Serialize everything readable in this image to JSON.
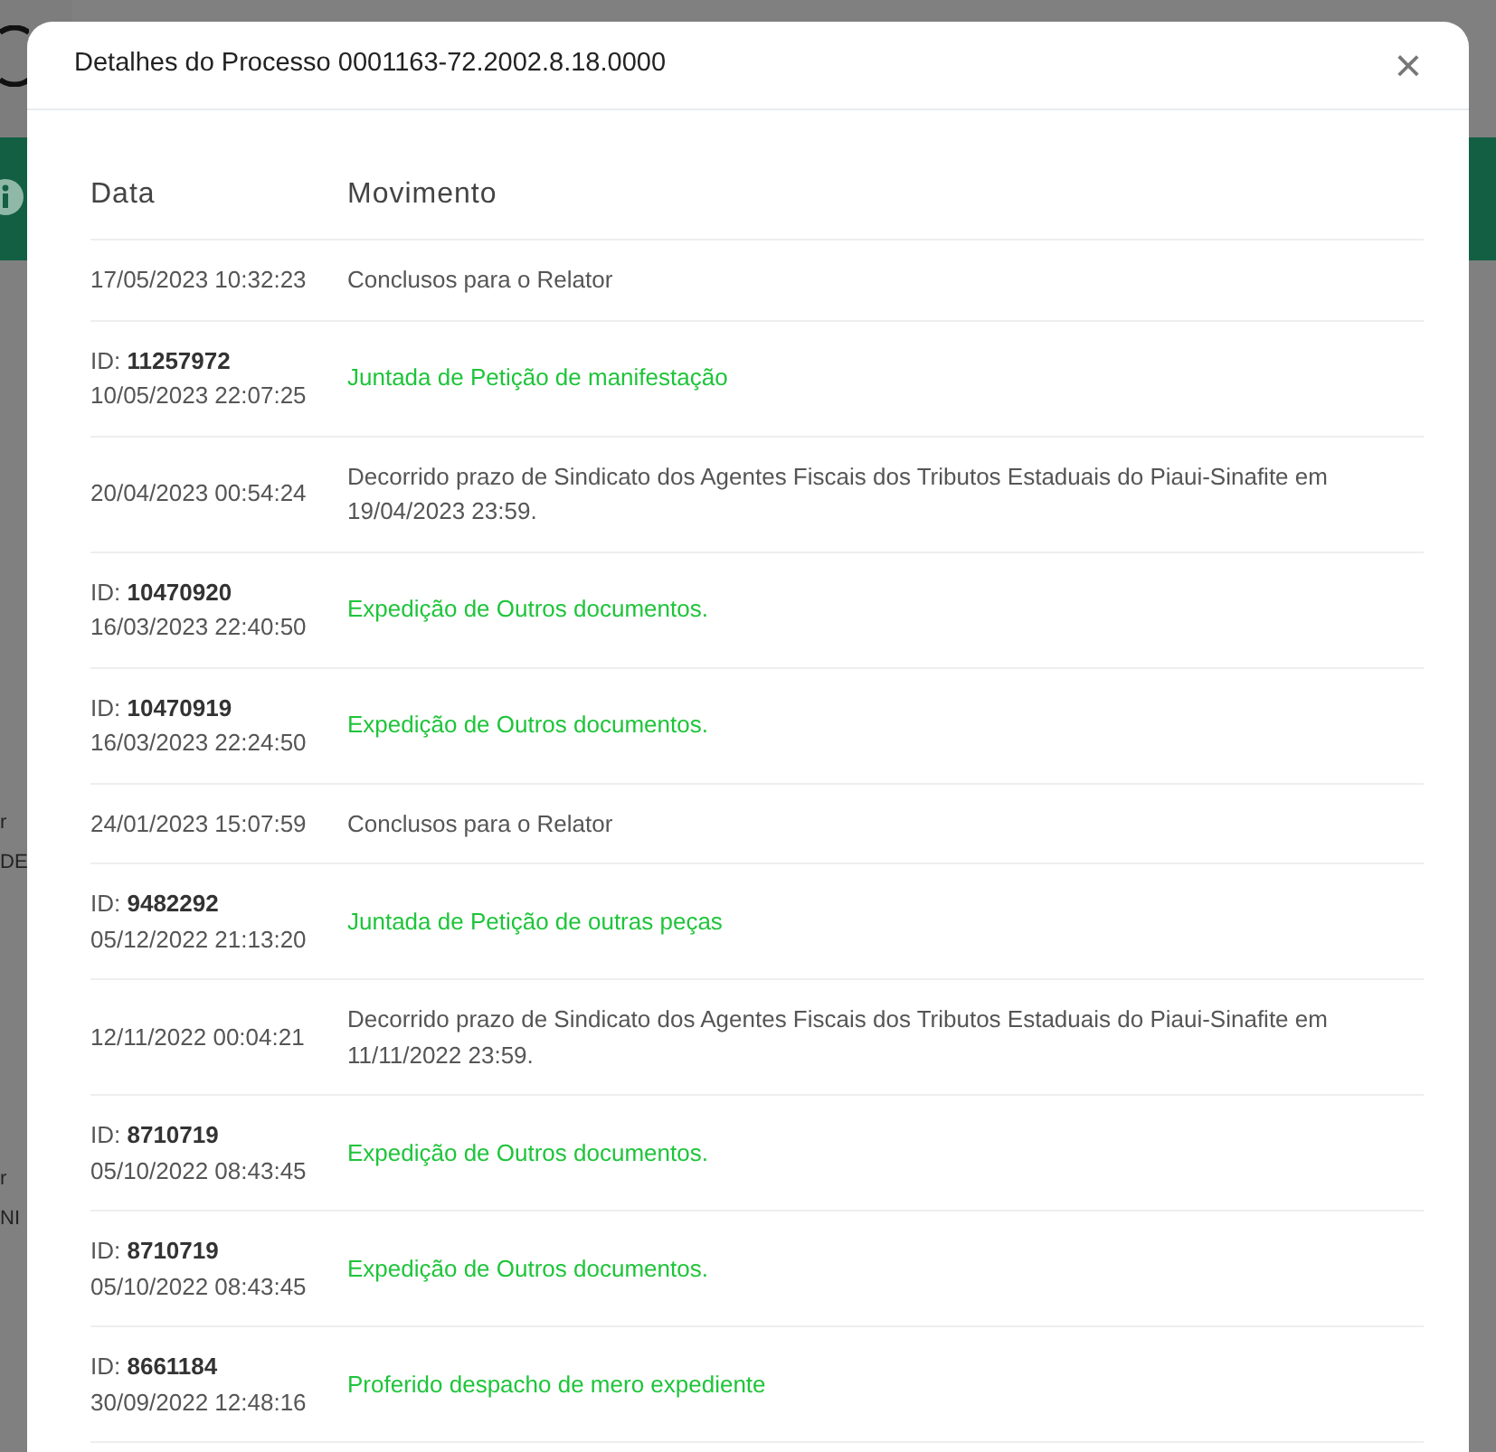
{
  "background": {
    "fragments": [
      "r",
      "DE",
      "r",
      "NI"
    ]
  },
  "modal": {
    "title": "Detalhes do Processo 0001163-72.2002.8.18.0000",
    "close": "×"
  },
  "table": {
    "columns": [
      "Data",
      "Movimento"
    ],
    "rows": [
      {
        "kind": "plain",
        "date": "17/05/2023 10:32:23",
        "movement": "Conclusos para o Relator"
      },
      {
        "kind": "document",
        "id_label": "ID:",
        "id": "11257972",
        "date": "10/05/2023 22:07:25",
        "movement": "Juntada de Petição de manifestação"
      },
      {
        "kind": "plain",
        "date": "20/04/2023 00:54:24",
        "movement": "Decorrido prazo de Sindicato dos Agentes Fiscais dos Tributos Estaduais do Piaui-Sinafite em 19/04/2023 23:59."
      },
      {
        "kind": "document",
        "id_label": "ID:",
        "id": "10470920",
        "date": "16/03/2023 22:40:50",
        "movement": "Expedição de Outros documentos."
      },
      {
        "kind": "document",
        "id_label": "ID:",
        "id": "10470919",
        "date": "16/03/2023 22:24:50",
        "movement": "Expedição de Outros documentos."
      },
      {
        "kind": "plain",
        "date": "24/01/2023 15:07:59",
        "movement": "Conclusos para o Relator"
      },
      {
        "kind": "document",
        "id_label": "ID:",
        "id": "9482292",
        "date": "05/12/2022 21:13:20",
        "movement": "Juntada de Petição de outras peças"
      },
      {
        "kind": "plain",
        "date": "12/11/2022 00:04:21",
        "movement": "Decorrido prazo de Sindicato dos Agentes Fiscais dos Tributos Estaduais do Piaui-Sinafite em 11/11/2022 23:59."
      },
      {
        "kind": "document",
        "id_label": "ID:",
        "id": "8710719",
        "date": "05/10/2022 08:43:45",
        "movement": "Expedição de Outros documentos."
      },
      {
        "kind": "document",
        "id_label": "ID:",
        "id": "8710719",
        "date": "05/10/2022 08:43:45",
        "movement": "Expedição de Outros documentos."
      },
      {
        "kind": "document",
        "id_label": "ID:",
        "id": "8661184",
        "date": "30/09/2022 12:48:16",
        "movement": "Proferido despacho de mero expediente"
      }
    ]
  }
}
